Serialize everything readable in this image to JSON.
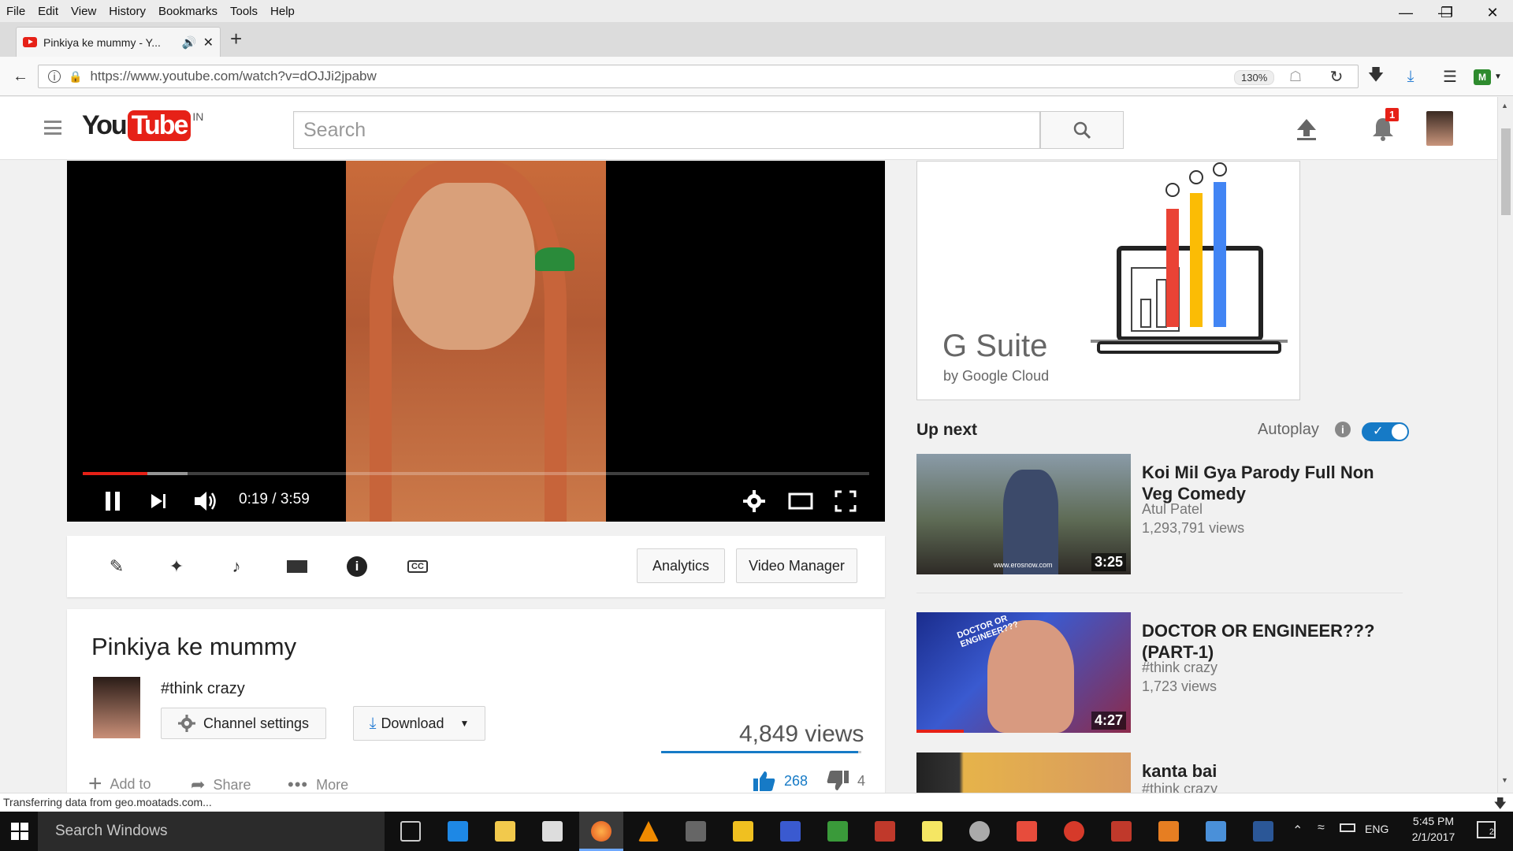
{
  "menubar": {
    "items": [
      "File",
      "Edit",
      "View",
      "History",
      "Bookmarks",
      "Tools",
      "Help"
    ]
  },
  "tab": {
    "title": "Pinkiya ke mummy - Y...",
    "new_tab": "+"
  },
  "address": {
    "url": "https://www.youtube.com/watch?v=dOJJi2jpabw",
    "zoom": "130%"
  },
  "youtube": {
    "logo_you": "You",
    "logo_tube": "Tube",
    "logo_region": "IN",
    "search_placeholder": "Search",
    "notification_count": "1"
  },
  "player": {
    "time": "0:19 / 3:59",
    "progress_fraction": 0.082,
    "buffered_fraction": 0.133
  },
  "creator": {
    "analytics": "Analytics",
    "video_manager": "Video Manager"
  },
  "video": {
    "title": "Pinkiya ke mummy",
    "channel": "#think crazy",
    "channel_settings": "Channel settings",
    "download": "Download",
    "views": "4,849 views",
    "add_to": "Add to",
    "share": "Share",
    "more": "More",
    "likes": "268",
    "dislikes": "4",
    "like_ratio": 0.985
  },
  "ad": {
    "brand": "G Suite",
    "byline": "by Google Cloud"
  },
  "upnext": {
    "heading": "Up next",
    "autoplay": "Autoplay",
    "items": [
      {
        "title": "Koi Mil Gya Parody Full Non Veg Comedy",
        "channel": "Atul Patel",
        "views": "1,293,791 views",
        "duration": "3:25",
        "watermark": "www.erosnow.com"
      },
      {
        "title": "DOCTOR OR ENGINEER??? (PART-1)",
        "channel": "#think crazy",
        "views": "1,723 views",
        "duration": "4:27",
        "overlay": "DOCTOR OR ENGINEER???"
      },
      {
        "title": "kanta bai",
        "channel": "#think crazy"
      }
    ]
  },
  "status": {
    "text": "Transferring data from geo.moatads.com..."
  },
  "taskbar": {
    "search": "Search Windows",
    "lang": "ENG",
    "time": "5:45 PM",
    "date": "2/1/2017",
    "notif": "2"
  },
  "colors": {
    "youtube_red": "#e62117",
    "link_blue": "#167ac6",
    "toggle_blue": "#167ac6"
  }
}
